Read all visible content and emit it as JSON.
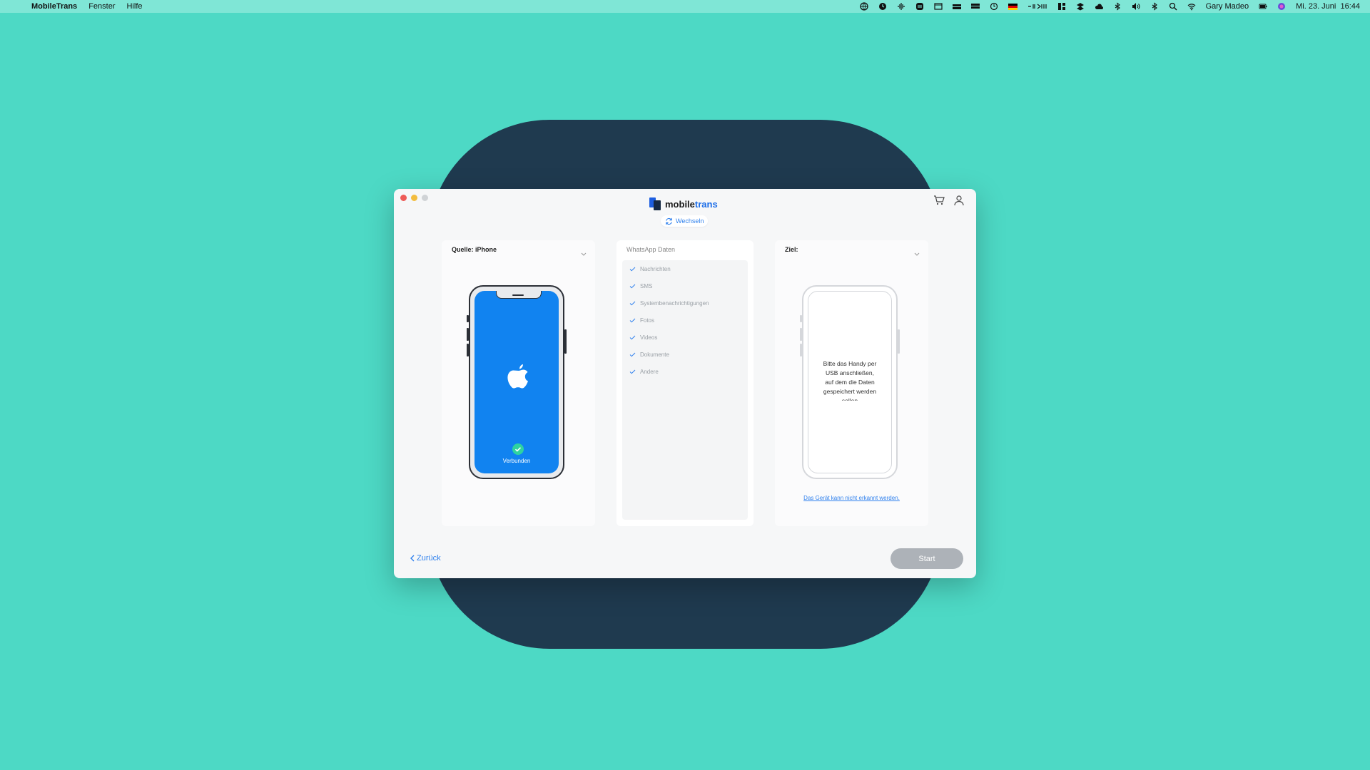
{
  "menubar": {
    "app_name": "MobileTrans",
    "menus": [
      "Fenster",
      "Hilfe"
    ],
    "user": "Gary Madeo",
    "datetime": "Mi. 23. Juni  16:44",
    "status_icons": [
      "globe-icon",
      "clock-icon",
      "audio-icon",
      "stack-icon",
      "window-icon",
      "drive-icon",
      "drive2-icon",
      "time-machine-icon",
      "german-flag-icon",
      "control-icon",
      "grid-icon",
      "dropbox-icon",
      "cloud-icon",
      "bluetooth-icon",
      "volume-icon",
      "bluetooth2-icon",
      "search-icon",
      "wifi-icon",
      "battery-icon",
      "siri-icon"
    ]
  },
  "window": {
    "brand": {
      "main": "mobile",
      "accent": "trans"
    },
    "switch_label": "Wechseln"
  },
  "source": {
    "title_label": "Quelle:",
    "title_value": "iPhone",
    "status": "Verbunden"
  },
  "data": {
    "title": "WhatsApp Daten",
    "items": [
      "Nachrichten",
      "SMS",
      "Systembenachrichtigungen",
      "Fotos",
      "Videos",
      "Dokumente",
      "Andere"
    ]
  },
  "target": {
    "title_label": "Ziel:",
    "message": "Bitte das Handy per\nUSB anschließen,\nauf dem die Daten\ngespeichert werden\nsollen",
    "link": "Das Gerät kann nicht erkannt werden."
  },
  "footer": {
    "back_label": "Zurück",
    "start_label": "Start"
  },
  "colors": {
    "background": "#4dd9c5",
    "backdrop": "#1f3a4f",
    "accent": "#2f80ed",
    "phone_screen": "#1183f0",
    "connected_check": "#2fd3a0",
    "start_disabled": "#adb2b8"
  }
}
